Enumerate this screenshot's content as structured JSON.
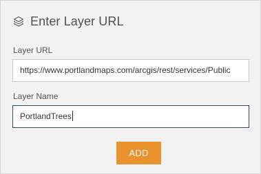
{
  "panel": {
    "title": "Enter Layer URL",
    "title_icon": "layers-icon"
  },
  "layer_url": {
    "label": "Layer URL",
    "value": "https://www.portlandmaps.com/arcgis/rest/services/Public"
  },
  "layer_name": {
    "label": "Layer Name",
    "value": "PortlandTrees"
  },
  "add_button": {
    "label": "ADD"
  },
  "colors": {
    "accent": "#e8912d",
    "focus_border": "#2f4b6e",
    "panel_background": "#f2f2f2"
  }
}
